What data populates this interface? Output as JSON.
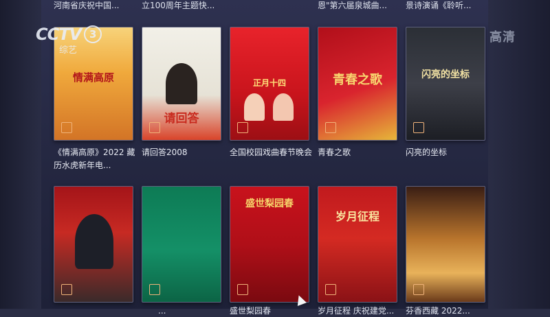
{
  "overlay": {
    "channel": "CCTV",
    "channel_number": "3",
    "channel_sub": "综艺",
    "hd": "高清"
  },
  "top_row_captions": [
    "河南省庆祝中国...",
    "立100周年主题快...",
    "恩\"第六届泉城曲...",
    "景诗演诵《聆听..."
  ],
  "row1": [
    {
      "caption": "《情满高原》2022 藏历水虎新年电...",
      "art": "情满高原"
    },
    {
      "caption": "请回答2008",
      "art": "请回答"
    },
    {
      "caption": "全国校园戏曲春节晚会",
      "art": "正月十四"
    },
    {
      "caption": "青春之歌",
      "art": "青春之歌"
    },
    {
      "caption": "闪亮的坐标",
      "art": "闪亮的坐标"
    }
  ],
  "row2": [
    {
      "caption": "",
      "art": ""
    },
    {
      "caption": "",
      "art": ""
    },
    {
      "caption": "盛世梨园春",
      "art": "盛世梨园春"
    },
    {
      "caption": "",
      "art": "岁月征程"
    },
    {
      "caption": "",
      "art": ""
    }
  ],
  "bottom_partial_captions": [
    "...",
    "盛世梨园春",
    "岁月征程 庆祝建党...",
    "芬香西藏 2022..."
  ],
  "colors": {
    "accent_checkbox": "#f0b37a",
    "background": "#2a2d45"
  }
}
